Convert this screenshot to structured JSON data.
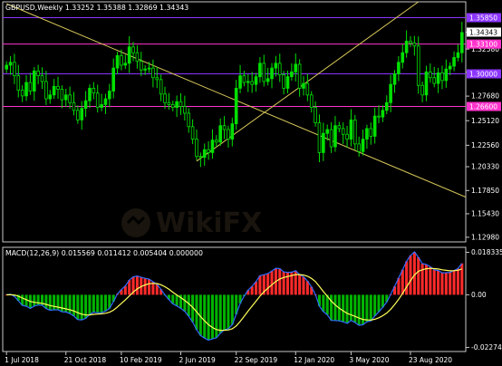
{
  "colors": {
    "background": "#000000",
    "axis": "#c8c8c8",
    "grid": "#2e2e2e",
    "candle": "#00e000",
    "trendline": "#d8c85a",
    "level_magenta": "#ff33cc",
    "level_purple": "#8c35ff",
    "price_marker": "#ffffff",
    "macd_pos": "#ff2a2a",
    "macd_neg": "#00b400",
    "macd_line": "#2f6bff",
    "signal_line": "#ffff5a"
  },
  "watermark": "WikiFX",
  "chart_data": [
    {
      "type": "candlestick",
      "title": "GBPUSD,Weekly  1.33252 1.35388 1.32869 1.34343",
      "ylim": [
        1.125,
        1.375
      ],
      "y_ticks": [
        "1.34343",
        "1.32580",
        "1.30165",
        "1.27680",
        "1.25120",
        "1.22560",
        "1.20330",
        "1.17850",
        "1.15430",
        "1.12980"
      ],
      "x_ticks": [
        "1 Jul 2018",
        "21 Oct 2018",
        "10 Feb 2019",
        "2 Jun 2019",
        "22 Sep 2019",
        "12 Jan 2020",
        "3 May 2020",
        "23 Aug 2020"
      ],
      "current_price": {
        "value": 1.34343,
        "label": "1.34343"
      },
      "levels": [
        {
          "value": 1.3585,
          "label": "1.35850",
          "color": "purple"
        },
        {
          "value": 1.331,
          "label": "1.33100",
          "color": "magenta"
        },
        {
          "value": 1.3,
          "label": "1.30000",
          "color": "purple"
        },
        {
          "value": 1.266,
          "label": "1.26600",
          "color": "magenta"
        }
      ],
      "trendlines": [
        {
          "from": [
            0,
            1.373
          ],
          "to": [
            129,
            1.149
          ]
        },
        {
          "from": [
            48,
            1.209
          ],
          "to": [
            104,
            1.375
          ]
        }
      ],
      "closes": [
        1.309,
        1.312,
        1.298,
        1.283,
        1.277,
        1.291,
        1.282,
        1.303,
        1.298,
        1.292,
        1.274,
        1.278,
        1.287,
        1.284,
        1.273,
        1.278,
        1.27,
        1.262,
        1.252,
        1.264,
        1.272,
        1.285,
        1.28,
        1.265,
        1.268,
        1.274,
        1.282,
        1.306,
        1.319,
        1.309,
        1.311,
        1.328,
        1.322,
        1.313,
        1.304,
        1.305,
        1.306,
        1.296,
        1.294,
        1.279,
        1.27,
        1.268,
        1.265,
        1.271,
        1.266,
        1.259,
        1.245,
        1.232,
        1.214,
        1.213,
        1.221,
        1.218,
        1.231,
        1.229,
        1.246,
        1.242,
        1.232,
        1.248,
        1.285,
        1.298,
        1.291,
        1.292,
        1.289,
        1.297,
        1.311,
        1.292,
        1.295,
        1.306,
        1.311,
        1.299,
        1.285,
        1.297,
        1.302,
        1.31,
        1.285,
        1.29,
        1.278,
        1.265,
        1.249,
        1.218,
        1.238,
        1.242,
        1.224,
        1.246,
        1.243,
        1.237,
        1.232,
        1.252,
        1.227,
        1.219,
        1.232,
        1.243,
        1.235,
        1.256,
        1.255,
        1.262,
        1.27,
        1.289,
        1.3,
        1.312,
        1.322,
        1.334,
        1.332,
        1.329,
        1.288,
        1.278,
        1.302,
        1.296,
        1.29,
        1.301,
        1.293,
        1.305,
        1.308,
        1.317,
        1.322,
        1.343
      ]
    },
    {
      "type": "macd",
      "title": "MACD(12,26,9) 0.015569 0.011412 0.005404 0.000000",
      "ylim": [
        -0.0245,
        0.0205
      ],
      "y_ticks": [
        "0.018335",
        "0.00",
        "-0.022748"
      ],
      "series_colors": {
        "histogram_positive": "#ff2a2a",
        "histogram_negative": "#00b400",
        "macd": "#2f6bff",
        "signal": "#ffff5a"
      }
    }
  ]
}
